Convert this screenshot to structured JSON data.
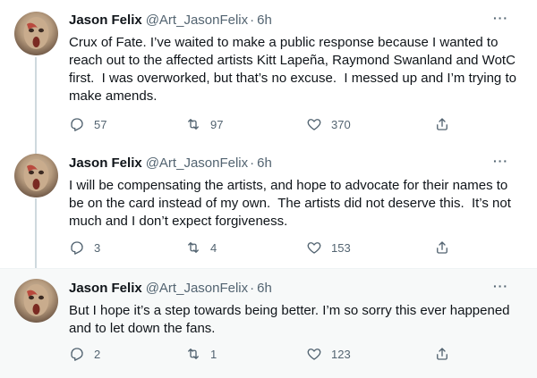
{
  "tweets": [
    {
      "name": "Jason Felix",
      "handle": "@Art_JasonFelix",
      "separator": "·",
      "time": "6h",
      "more": "···",
      "text": "Crux of Fate. I’ve waited to make a public response because I wanted to reach out to the affected artists Kitt Lapeña, Raymond Swanland and WotC first.  I was overworked, but that’s no excuse.  I messed up and I’m trying to make amends.",
      "replies": "57",
      "retweets": "97",
      "likes": "370"
    },
    {
      "name": "Jason Felix",
      "handle": "@Art_JasonFelix",
      "separator": "·",
      "time": "6h",
      "more": "···",
      "text": "I will be compensating the artists, and hope to advocate for their names to be on the card instead of my own.  The artists did not deserve this.  It’s not much and I don’t expect forgiveness.",
      "replies": "3",
      "retweets": "4",
      "likes": "153"
    },
    {
      "name": "Jason Felix",
      "handle": "@Art_JasonFelix",
      "separator": "·",
      "time": "6h",
      "more": "···",
      "text": "But I hope it’s a step towards being better. I’m so sorry this ever happened and to let down the fans.",
      "replies": "2",
      "retweets": "1",
      "likes": "123"
    }
  ],
  "icons": {
    "reply": "reply-icon",
    "retweet": "retweet-icon",
    "like": "heart-icon",
    "share": "share-icon",
    "more": "more-icon"
  },
  "colors": {
    "text": "#0f1419",
    "secondary": "#536471",
    "thread_line": "#cfd9de",
    "highlight_background": "#f7f9f9"
  }
}
